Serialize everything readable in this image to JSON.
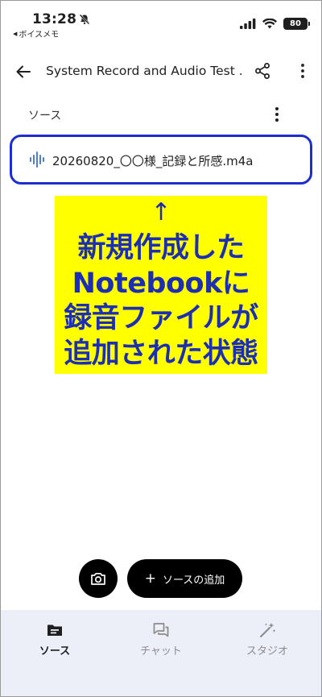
{
  "status_bar": {
    "time": "13:28",
    "back_app": "ボイスメモ",
    "battery": "80"
  },
  "app_bar": {
    "title": "System Record and Audio Test ..."
  },
  "sources": {
    "header": "ソース",
    "items": [
      {
        "name": "20260820_〇〇様_記録と所感.m4a",
        "icon": "audio-wave-icon"
      }
    ]
  },
  "annotation": {
    "arrow": "↑",
    "lines": [
      "新規作成した",
      "Notebookに",
      "録音ファイルが",
      "追加された状態"
    ],
    "background_color": "#ffff00",
    "text_color": "#1c2eb2"
  },
  "actions": {
    "camera_icon": "camera-icon",
    "add_plus": "+",
    "add_label": "ソースの追加"
  },
  "bottom_nav": {
    "items": [
      {
        "label": "ソース",
        "icon": "folder-icon",
        "active": true
      },
      {
        "label": "チャット",
        "icon": "chat-icon",
        "active": false
      },
      {
        "label": "スタジオ",
        "icon": "magic-wand-icon",
        "active": false
      }
    ]
  },
  "colors": {
    "highlight_border": "#1c2ecf",
    "nav_background": "#eceef8",
    "source_icon": "#4a7fd4"
  }
}
